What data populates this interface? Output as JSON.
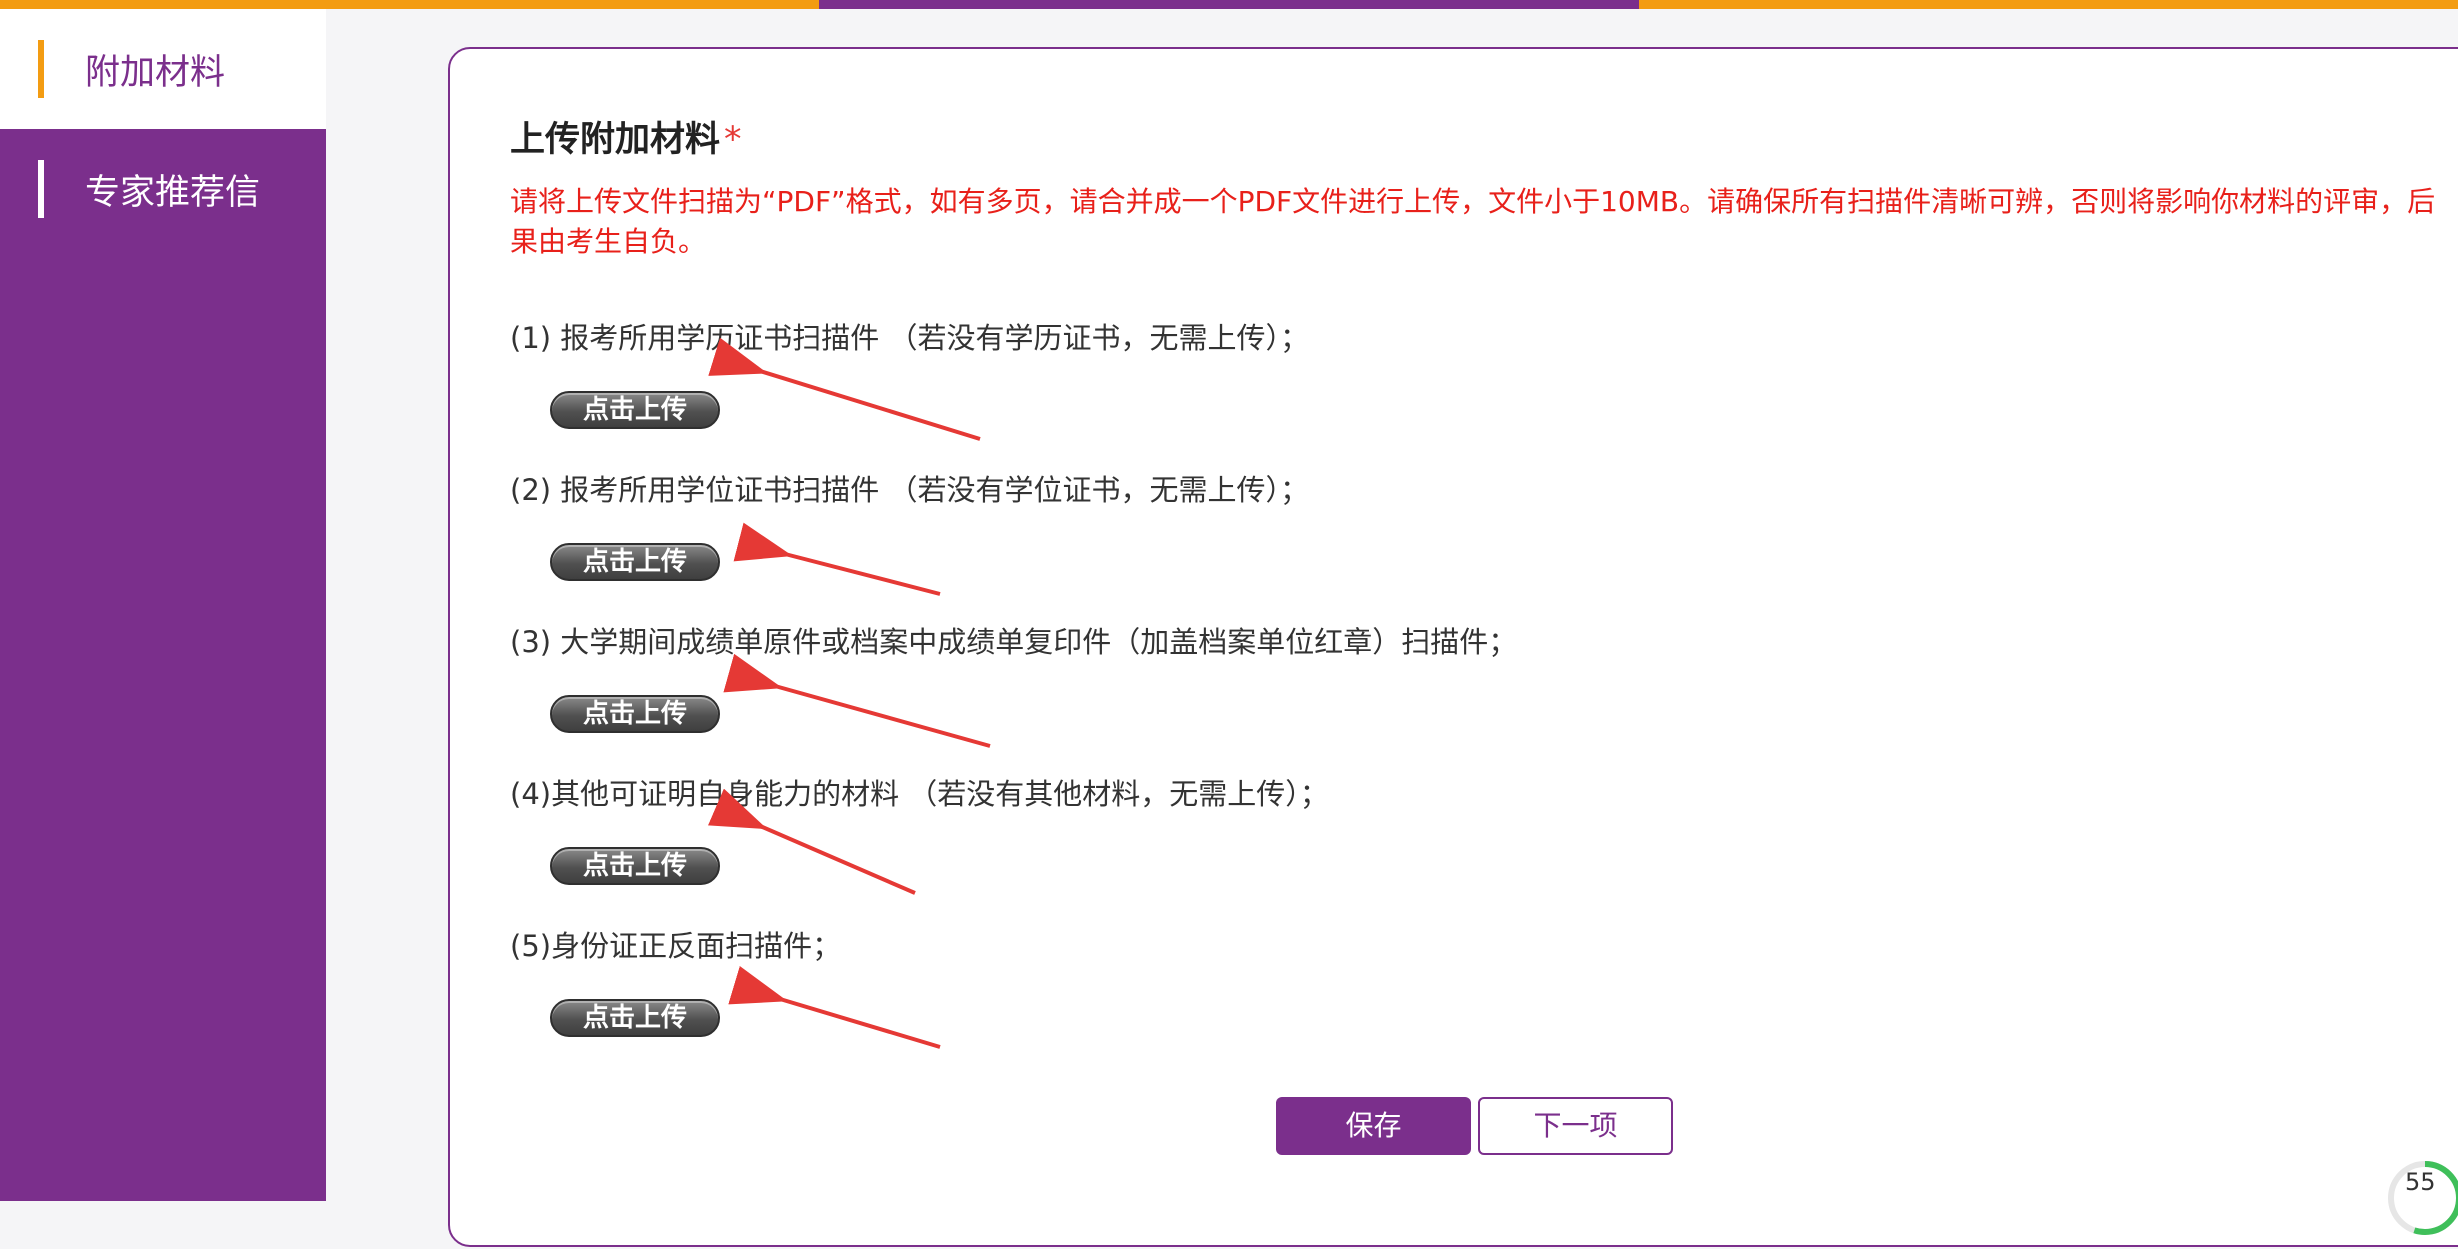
{
  "colors": {
    "brand_purple": "#7b2f8c",
    "accent_orange": "#f39c12",
    "notice_red": "#e8201a",
    "arrow_red": "#e53935"
  },
  "top_bar_segments": [
    "#f39c12",
    "#7b2f8c",
    "#f39c12"
  ],
  "sidebar": {
    "items": [
      {
        "label": "附加材料",
        "active": true
      },
      {
        "label": "专家推荐信",
        "active": false
      }
    ]
  },
  "main": {
    "title": "上传附加材料",
    "required_mark": "*",
    "notice": "请将上传文件扫描为“PDF”格式，如有多页，请合并成一个PDF文件进行上传，文件小于10MB。请确保所有扫描件清晰可辨，否则将影响你材料的评审，后果由考生自负。",
    "upload_button_label": "点击上传",
    "items": [
      {
        "label": "(1) 报考所用学历证书扫描件 （若没有学历证书，无需上传）；"
      },
      {
        "label": "(2) 报考所用学位证书扫描件 （若没有学位证书，无需上传）；"
      },
      {
        "label": "(3) 大学期间成绩单原件或档案中成绩单复印件（加盖档案单位红章）扫描件；"
      },
      {
        "label": "(4)其他可证明自身能力的材料 （若没有其他材料，无需上传）；"
      },
      {
        "label": "(5)身份证正反面扫描件；"
      }
    ],
    "save_label": "保存",
    "next_label": "下一项"
  },
  "progress": {
    "value_text": "55",
    "percent": 55
  }
}
